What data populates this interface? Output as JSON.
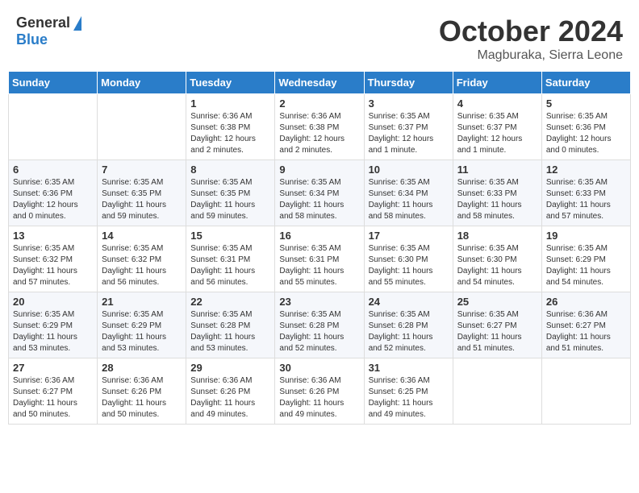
{
  "logo": {
    "general": "General",
    "blue": "Blue"
  },
  "title": "October 2024",
  "location": "Magburaka, Sierra Leone",
  "days_header": [
    "Sunday",
    "Monday",
    "Tuesday",
    "Wednesday",
    "Thursday",
    "Friday",
    "Saturday"
  ],
  "weeks": [
    [
      {
        "day": "",
        "info": ""
      },
      {
        "day": "",
        "info": ""
      },
      {
        "day": "1",
        "info": "Sunrise: 6:36 AM\nSunset: 6:38 PM\nDaylight: 12 hours and 2 minutes."
      },
      {
        "day": "2",
        "info": "Sunrise: 6:36 AM\nSunset: 6:38 PM\nDaylight: 12 hours and 2 minutes."
      },
      {
        "day": "3",
        "info": "Sunrise: 6:35 AM\nSunset: 6:37 PM\nDaylight: 12 hours and 1 minute."
      },
      {
        "day": "4",
        "info": "Sunrise: 6:35 AM\nSunset: 6:37 PM\nDaylight: 12 hours and 1 minute."
      },
      {
        "day": "5",
        "info": "Sunrise: 6:35 AM\nSunset: 6:36 PM\nDaylight: 12 hours and 0 minutes."
      }
    ],
    [
      {
        "day": "6",
        "info": "Sunrise: 6:35 AM\nSunset: 6:36 PM\nDaylight: 12 hours and 0 minutes."
      },
      {
        "day": "7",
        "info": "Sunrise: 6:35 AM\nSunset: 6:35 PM\nDaylight: 11 hours and 59 minutes."
      },
      {
        "day": "8",
        "info": "Sunrise: 6:35 AM\nSunset: 6:35 PM\nDaylight: 11 hours and 59 minutes."
      },
      {
        "day": "9",
        "info": "Sunrise: 6:35 AM\nSunset: 6:34 PM\nDaylight: 11 hours and 58 minutes."
      },
      {
        "day": "10",
        "info": "Sunrise: 6:35 AM\nSunset: 6:34 PM\nDaylight: 11 hours and 58 minutes."
      },
      {
        "day": "11",
        "info": "Sunrise: 6:35 AM\nSunset: 6:33 PM\nDaylight: 11 hours and 58 minutes."
      },
      {
        "day": "12",
        "info": "Sunrise: 6:35 AM\nSunset: 6:33 PM\nDaylight: 11 hours and 57 minutes."
      }
    ],
    [
      {
        "day": "13",
        "info": "Sunrise: 6:35 AM\nSunset: 6:32 PM\nDaylight: 11 hours and 57 minutes."
      },
      {
        "day": "14",
        "info": "Sunrise: 6:35 AM\nSunset: 6:32 PM\nDaylight: 11 hours and 56 minutes."
      },
      {
        "day": "15",
        "info": "Sunrise: 6:35 AM\nSunset: 6:31 PM\nDaylight: 11 hours and 56 minutes."
      },
      {
        "day": "16",
        "info": "Sunrise: 6:35 AM\nSunset: 6:31 PM\nDaylight: 11 hours and 55 minutes."
      },
      {
        "day": "17",
        "info": "Sunrise: 6:35 AM\nSunset: 6:30 PM\nDaylight: 11 hours and 55 minutes."
      },
      {
        "day": "18",
        "info": "Sunrise: 6:35 AM\nSunset: 6:30 PM\nDaylight: 11 hours and 54 minutes."
      },
      {
        "day": "19",
        "info": "Sunrise: 6:35 AM\nSunset: 6:29 PM\nDaylight: 11 hours and 54 minutes."
      }
    ],
    [
      {
        "day": "20",
        "info": "Sunrise: 6:35 AM\nSunset: 6:29 PM\nDaylight: 11 hours and 53 minutes."
      },
      {
        "day": "21",
        "info": "Sunrise: 6:35 AM\nSunset: 6:29 PM\nDaylight: 11 hours and 53 minutes."
      },
      {
        "day": "22",
        "info": "Sunrise: 6:35 AM\nSunset: 6:28 PM\nDaylight: 11 hours and 53 minutes."
      },
      {
        "day": "23",
        "info": "Sunrise: 6:35 AM\nSunset: 6:28 PM\nDaylight: 11 hours and 52 minutes."
      },
      {
        "day": "24",
        "info": "Sunrise: 6:35 AM\nSunset: 6:28 PM\nDaylight: 11 hours and 52 minutes."
      },
      {
        "day": "25",
        "info": "Sunrise: 6:35 AM\nSunset: 6:27 PM\nDaylight: 11 hours and 51 minutes."
      },
      {
        "day": "26",
        "info": "Sunrise: 6:36 AM\nSunset: 6:27 PM\nDaylight: 11 hours and 51 minutes."
      }
    ],
    [
      {
        "day": "27",
        "info": "Sunrise: 6:36 AM\nSunset: 6:27 PM\nDaylight: 11 hours and 50 minutes."
      },
      {
        "day": "28",
        "info": "Sunrise: 6:36 AM\nSunset: 6:26 PM\nDaylight: 11 hours and 50 minutes."
      },
      {
        "day": "29",
        "info": "Sunrise: 6:36 AM\nSunset: 6:26 PM\nDaylight: 11 hours and 49 minutes."
      },
      {
        "day": "30",
        "info": "Sunrise: 6:36 AM\nSunset: 6:26 PM\nDaylight: 11 hours and 49 minutes."
      },
      {
        "day": "31",
        "info": "Sunrise: 6:36 AM\nSunset: 6:25 PM\nDaylight: 11 hours and 49 minutes."
      },
      {
        "day": "",
        "info": ""
      },
      {
        "day": "",
        "info": ""
      }
    ]
  ]
}
